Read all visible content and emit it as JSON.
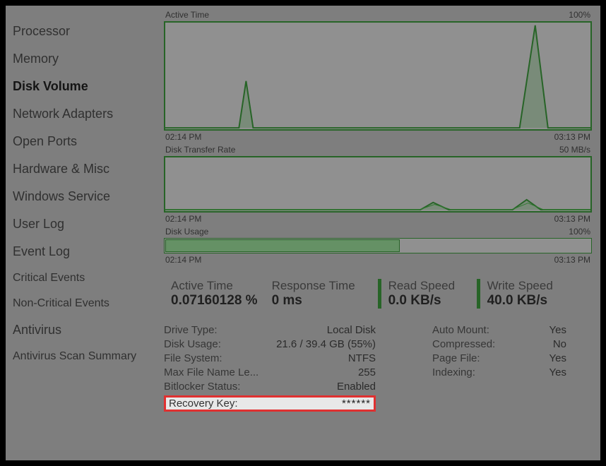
{
  "sidebar": {
    "items": [
      {
        "label": "Processor"
      },
      {
        "label": "Memory"
      },
      {
        "label": "Disk Volume"
      },
      {
        "label": "Network Adapters"
      },
      {
        "label": "Open Ports"
      },
      {
        "label": "Hardware & Misc"
      },
      {
        "label": "Windows Service"
      },
      {
        "label": "User Log"
      },
      {
        "label": "Event Log"
      },
      {
        "label": "Critical Events"
      },
      {
        "label": "Non-Critical Events"
      },
      {
        "label": "Antivirus"
      },
      {
        "label": "Antivirus Scan Summary"
      }
    ],
    "active_index": 2
  },
  "charts": {
    "active_time": {
      "title": "Active Time",
      "max": "100%",
      "start": "02:14 PM",
      "end": "03:13 PM"
    },
    "transfer_rate": {
      "title": "Disk Transfer Rate",
      "max": "50 MB/s",
      "start": "02:14 PM",
      "end": "03:13 PM"
    },
    "usage": {
      "title": "Disk Usage",
      "max": "100%",
      "start": "02:14 PM",
      "end": "03:13 PM",
      "percent": 55
    }
  },
  "stats": {
    "active_time": {
      "label": "Active Time",
      "value": "0.07160128 %"
    },
    "response_time": {
      "label": "Response Time",
      "value": "0 ms"
    },
    "read_speed": {
      "label": "Read Speed",
      "value": "0.0 KB/s"
    },
    "write_speed": {
      "label": "Write Speed",
      "value": "40.0 KB/s"
    }
  },
  "details": {
    "left": [
      {
        "k": "Drive Type:",
        "v": "Local Disk"
      },
      {
        "k": "Disk Usage:",
        "v": "21.6 / 39.4 GB (55%)"
      },
      {
        "k": "File System:",
        "v": "NTFS"
      },
      {
        "k": "Max File Name Le...",
        "v": "255"
      },
      {
        "k": "Bitlocker Status:",
        "v": "Enabled"
      }
    ],
    "recovery": {
      "k": "Recovery Key:",
      "v": "******"
    },
    "right": [
      {
        "k": "Auto Mount:",
        "v": "Yes"
      },
      {
        "k": "Compressed:",
        "v": "No"
      },
      {
        "k": "Page File:",
        "v": "Yes"
      },
      {
        "k": "Indexing:",
        "v": "Yes"
      }
    ]
  },
  "chart_data": [
    {
      "type": "area",
      "title": "Active Time",
      "xlabel": "",
      "ylabel": "",
      "ylim": [
        0,
        100
      ],
      "x_range": [
        "02:14 PM",
        "03:13 PM"
      ],
      "series": [
        {
          "name": "Active Time %",
          "approx_spikes": [
            {
              "t_frac": 0.19,
              "peak_pct": 45
            },
            {
              "t_frac": 0.87,
              "peak_pct": 98
            }
          ]
        }
      ]
    },
    {
      "type": "area",
      "title": "Disk Transfer Rate",
      "xlabel": "",
      "ylabel": "",
      "ylim": [
        0,
        50
      ],
      "x_range": [
        "02:14 PM",
        "03:13 PM"
      ],
      "series": [
        {
          "name": "MB/s",
          "approx_spikes": [
            {
              "t_frac": 0.63,
              "peak_mbs": 7
            },
            {
              "t_frac": 0.85,
              "peak_mbs": 10
            }
          ]
        }
      ]
    },
    {
      "type": "bar",
      "title": "Disk Usage",
      "categories": [
        "Usage"
      ],
      "values": [
        55
      ],
      "ylim": [
        0,
        100
      ]
    }
  ]
}
